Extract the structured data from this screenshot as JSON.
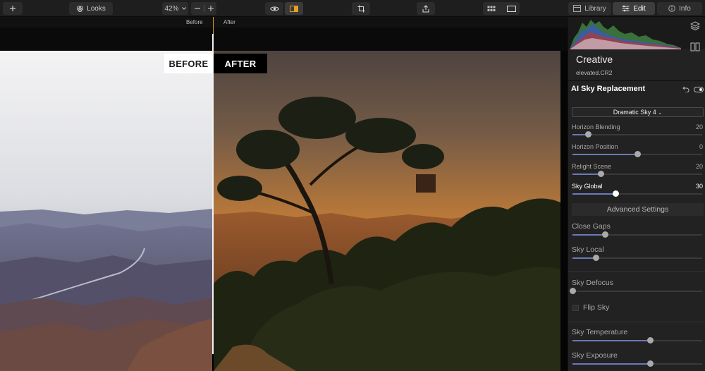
{
  "toolbar": {
    "looks_label": "Looks",
    "zoom_value": "42%",
    "tabs": [
      {
        "label": "Library"
      },
      {
        "label": "Edit"
      },
      {
        "label": "Info"
      }
    ]
  },
  "viewer": {
    "before_label": "Before",
    "after_label": "After",
    "before_badge": "BEFORE",
    "after_badge": "AFTER"
  },
  "panel": {
    "title": "Creative",
    "file_name": "elevated.CR2",
    "section_title": "AI Sky Replacement",
    "sky_dropdown": "Dramatic Sky 4",
    "sliders": [
      {
        "label": "Horizon Blending",
        "value": "20",
        "position": 0.12
      },
      {
        "label": "Horizon Position",
        "value": "0",
        "position": 0.5
      },
      {
        "label": "Relight Scene",
        "value": "20",
        "position": 0.22
      },
      {
        "label": "Sky Global",
        "value": "30",
        "position": 0.33
      }
    ],
    "advanced_label": "Advanced Settings",
    "advanced_sliders": [
      {
        "label": "Close Gaps",
        "position": 0.25
      },
      {
        "label": "Sky Local",
        "position": 0.18
      },
      {
        "label": "Sky Defocus",
        "position": 0.0
      },
      {
        "label": "Sky Temperature",
        "position": 0.6
      },
      {
        "label": "Sky Exposure",
        "position": 0.6
      }
    ],
    "flip_sky_label": "Flip Sky",
    "flip_sky_checked": false
  },
  "colors": {
    "accent": "#e0a020",
    "slider_fill": "#6c78b8",
    "panel_bg": "#222222"
  }
}
